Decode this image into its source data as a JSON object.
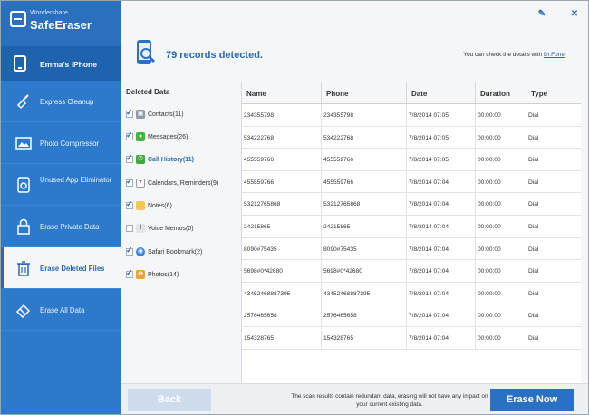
{
  "brand": {
    "small": "Wondershare",
    "name": "SafeEraser"
  },
  "device": {
    "name": "Emma's iPhone"
  },
  "sidebar": {
    "items": [
      {
        "label": "Express Cleanup",
        "icon": "broom-icon"
      },
      {
        "label": "Photo Compressor",
        "icon": "photo-icon"
      },
      {
        "label": "Unused App Eliminator",
        "icon": "apps-icon"
      },
      {
        "label": "Erase Private Data",
        "icon": "lock-icon"
      },
      {
        "label": "Erase Deleted Files",
        "icon": "trash-icon",
        "active": true
      },
      {
        "label": "Erase All Data",
        "icon": "eraser-icon"
      }
    ]
  },
  "header": {
    "records": "79 records detected.",
    "detail_prefix": "You can check the details with",
    "detail_link": "Dr.Fone"
  },
  "deleted_data": {
    "title": "Deleted Data",
    "items": [
      {
        "label": "Contacts(11)",
        "checked": true,
        "color": "#8d9aa6",
        "icon": "contacts-icon"
      },
      {
        "label": "Messages(26)",
        "checked": true,
        "color": "#45b53f",
        "icon": "messages-icon"
      },
      {
        "label": "Call History(11)",
        "checked": true,
        "color": "#3fa93a",
        "icon": "phone-icon",
        "selected": true
      },
      {
        "label": "Calendars, Reminders(9)",
        "checked": true,
        "color": "#ffffff",
        "icon": "calendar-icon"
      },
      {
        "label": "Notes(6)",
        "checked": true,
        "color": "#f2c94c",
        "icon": "notes-icon"
      },
      {
        "label": "Voice Memos(0)",
        "checked": false,
        "color": "#7c7c7c",
        "icon": "voice-memo-icon"
      },
      {
        "label": "Safari Bookmark(2)",
        "checked": true,
        "color": "#3a86d6",
        "icon": "safari-icon"
      },
      {
        "label": "Photos(14)",
        "checked": true,
        "color": "#e8a33a",
        "icon": "photos-icon"
      }
    ]
  },
  "table": {
    "headers": [
      "Name",
      "Phone",
      "Date",
      "Duration",
      "Type"
    ],
    "rows": [
      [
        "234355798",
        "234355798",
        "7/8/2014 07:05",
        "00:00:00",
        "Dial"
      ],
      [
        "534222768",
        "534222768",
        "7/8/2014 07:05",
        "00:00:00",
        "Dial"
      ],
      [
        "455559766",
        "455559766",
        "7/8/2014 07:05",
        "00:00:00",
        "Dial"
      ],
      [
        "455559766",
        "455559766",
        "7/8/2014 07:04",
        "00:00:00",
        "Dial"
      ],
      [
        "53212765868",
        "53212765868",
        "7/8/2014 07:04",
        "00:00:00",
        "Dial"
      ],
      [
        "24215865",
        "24215865",
        "7/8/2014 07:04",
        "00:00:00",
        "Dial"
      ],
      [
        "8090#75435",
        "8090#75435",
        "7/8/2014 07:04",
        "00:00:00",
        "Dial"
      ],
      [
        "5698#0*42680",
        "5698#0*42680",
        "7/8/2014 07:04",
        "00:00:00",
        "Dial"
      ],
      [
        "43452468887395",
        "43452468887395",
        "7/8/2014 07:04",
        "00:00:00",
        "Dial"
      ],
      [
        "2576465658",
        "2576465658",
        "7/8/2014 07:04",
        "00:00:00",
        "Dial"
      ],
      [
        "154328765",
        "154328765",
        "7/8/2014 07:04",
        "00:00:00",
        "Dial"
      ]
    ]
  },
  "footer": {
    "back_label": "Back",
    "note": "The scan results contain redundant data, erasing will not have any impact on your current existing data.",
    "erase_label": "Erase Now"
  },
  "window": {
    "feedback_icon": "feedback-icon",
    "minimize_icon": "minimize-icon",
    "close_icon": "close-icon"
  }
}
